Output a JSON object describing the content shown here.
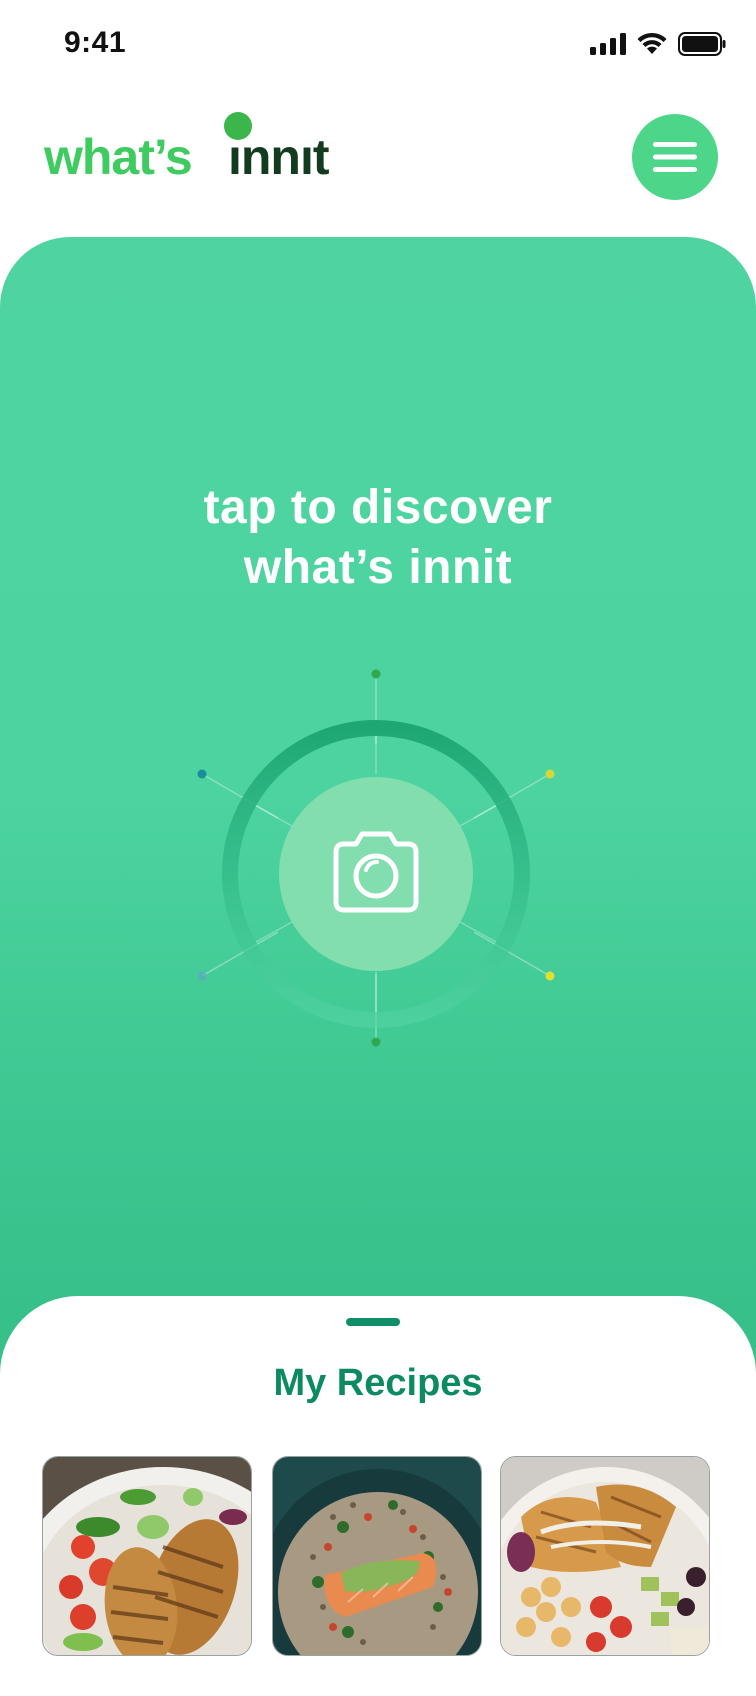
{
  "status_bar": {
    "time": "9:41",
    "icons": [
      "signal-icon",
      "wifi-icon",
      "battery-icon"
    ]
  },
  "header": {
    "logo_part1": "what’s",
    "logo_part2": "ınnıt",
    "menu_icon": "hamburger-menu-icon"
  },
  "hero": {
    "line1": "tap to discover",
    "line2": "what’s innit",
    "action_icon": "camera-icon"
  },
  "recipes_sheet": {
    "title": "My Recipes",
    "recipes": [
      {
        "image": "chicken-salad-photo"
      },
      {
        "image": "salmon-grain-bowl-photo"
      },
      {
        "image": "chickpea-chicken-bowl-photo"
      }
    ]
  },
  "colors": {
    "brand_green": "#3ecb5f",
    "logo_dark": "#123b1f",
    "hero_green": "#4cd39f",
    "menu_button": "#4dd68a",
    "sheet_title": "#0c8a63"
  }
}
